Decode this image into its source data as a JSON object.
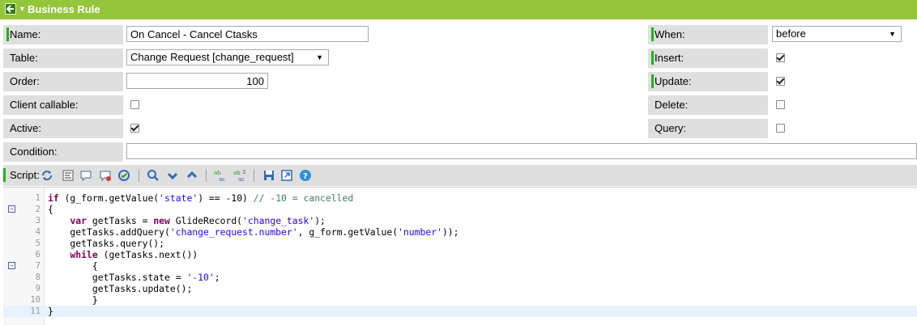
{
  "header": {
    "title": "Business Rule"
  },
  "form": {
    "name": {
      "label": "Name:",
      "value": "On Cancel - Cancel Ctasks"
    },
    "table": {
      "label": "Table:",
      "value": "Change Request [change_request]"
    },
    "order": {
      "label": "Order:",
      "value": "100"
    },
    "client_callable": {
      "label": "Client callable:",
      "checked": false
    },
    "active": {
      "label": "Active:",
      "checked": true
    },
    "condition": {
      "label": "Condition:",
      "value": ""
    },
    "when": {
      "label": "When:",
      "value": "before"
    },
    "insert": {
      "label": "Insert:",
      "checked": true
    },
    "update": {
      "label": "Update:",
      "checked": true
    },
    "delete": {
      "label": "Delete:",
      "checked": false
    },
    "query": {
      "label": "Query:",
      "checked": false
    }
  },
  "script": {
    "label": "Script:",
    "toolbar_icons": [
      "toggle-syntax-icon",
      "format-code-icon",
      "comment-icon",
      "uncomment-icon",
      "check-syntax-icon",
      "search-icon",
      "find-next-icon",
      "find-previous-icon",
      "replace-icon",
      "replace-all-icon",
      "save-icon",
      "fullscreen-icon",
      "help-icon"
    ],
    "lines": [
      {
        "n": "1",
        "text": "if (g_form.getValue('state') == -10) // -10 = cancelled"
      },
      {
        "n": "2",
        "text": "{"
      },
      {
        "n": "3",
        "text": "    var getTasks = new GlideRecord('change_task');"
      },
      {
        "n": "4",
        "text": "    getTasks.addQuery('change_request.number', g_form.getValue('number'));"
      },
      {
        "n": "5",
        "text": "    getTasks.query();"
      },
      {
        "n": "6",
        "text": "    while (getTasks.next())"
      },
      {
        "n": "7",
        "text": "        {"
      },
      {
        "n": "8",
        "text": "        getTasks.state = '-10';"
      },
      {
        "n": "9",
        "text": "        getTasks.update();"
      },
      {
        "n": "10",
        "text": "        }"
      },
      {
        "n": "11",
        "text": "}"
      }
    ]
  },
  "colors": {
    "header_bg": "#95c53a",
    "label_bg": "#dfdfdf",
    "mandatory": "#1db31d"
  }
}
